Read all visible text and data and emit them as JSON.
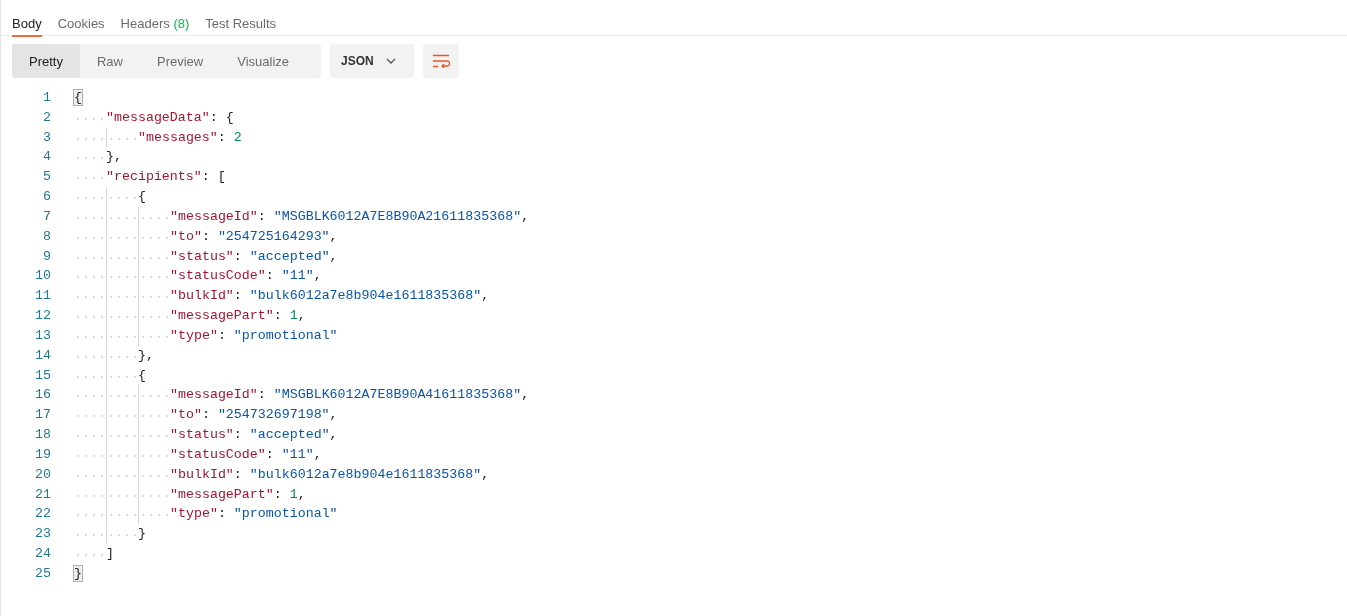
{
  "tabs": [
    {
      "label": "Body",
      "selected": true
    },
    {
      "label": "Cookies",
      "selected": false
    },
    {
      "label": "Headers",
      "count": "(8)",
      "selected": false
    },
    {
      "label": "Test Results",
      "selected": false
    }
  ],
  "view_modes": [
    {
      "label": "Pretty",
      "selected": true
    },
    {
      "label": "Raw",
      "selected": false
    },
    {
      "label": "Preview",
      "selected": false
    },
    {
      "label": "Visualize",
      "selected": false
    }
  ],
  "format_dropdown": {
    "value": "JSON"
  },
  "code": [
    {
      "number": "1",
      "tokens": [
        {
          "kind": "bracket-match",
          "text": "{"
        }
      ],
      "children": [
        {
          "number": "2",
          "tokens": [
            {
              "kind": "key",
              "text": "\"messageData\""
            },
            {
              "kind": "punct",
              "text": ": {"
            }
          ],
          "children": [
            {
              "number": "3",
              "tokens": [
                {
                  "kind": "key",
                  "text": "\"messages\""
                },
                {
                  "kind": "punct",
                  "text": ": "
                },
                {
                  "kind": "number",
                  "text": "2"
                }
              ]
            }
          ]
        },
        {
          "number": "4",
          "tokens": [
            {
              "kind": "punct",
              "text": "},"
            }
          ]
        },
        {
          "number": "5",
          "tokens": [
            {
              "kind": "key",
              "text": "\"recipients\""
            },
            {
              "kind": "punct",
              "text": ": ["
            }
          ],
          "children": [
            {
              "number": "6",
              "tokens": [
                {
                  "kind": "punct",
                  "text": "{"
                }
              ],
              "children": [
                {
                  "number": "7",
                  "tokens": [
                    {
                      "kind": "key",
                      "text": "\"messageId\""
                    },
                    {
                      "kind": "punct",
                      "text": ": "
                    },
                    {
                      "kind": "string",
                      "text": "\"MSGBLK6012A7E8B90A21611835368\""
                    },
                    {
                      "kind": "punct",
                      "text": ","
                    }
                  ]
                },
                {
                  "number": "8",
                  "tokens": [
                    {
                      "kind": "key",
                      "text": "\"to\""
                    },
                    {
                      "kind": "punct",
                      "text": ": "
                    },
                    {
                      "kind": "string",
                      "text": "\"254725164293\""
                    },
                    {
                      "kind": "punct",
                      "text": ","
                    }
                  ]
                },
                {
                  "number": "9",
                  "tokens": [
                    {
                      "kind": "key",
                      "text": "\"status\""
                    },
                    {
                      "kind": "punct",
                      "text": ": "
                    },
                    {
                      "kind": "string",
                      "text": "\"accepted\""
                    },
                    {
                      "kind": "punct",
                      "text": ","
                    }
                  ]
                },
                {
                  "number": "10",
                  "tokens": [
                    {
                      "kind": "key",
                      "text": "\"statusCode\""
                    },
                    {
                      "kind": "punct",
                      "text": ": "
                    },
                    {
                      "kind": "string",
                      "text": "\"11\""
                    },
                    {
                      "kind": "punct",
                      "text": ","
                    }
                  ]
                },
                {
                  "number": "11",
                  "tokens": [
                    {
                      "kind": "key",
                      "text": "\"bulkId\""
                    },
                    {
                      "kind": "punct",
                      "text": ": "
                    },
                    {
                      "kind": "string",
                      "text": "\"bulk6012a7e8b904e1611835368\""
                    },
                    {
                      "kind": "punct",
                      "text": ","
                    }
                  ]
                },
                {
                  "number": "12",
                  "tokens": [
                    {
                      "kind": "key",
                      "text": "\"messagePart\""
                    },
                    {
                      "kind": "punct",
                      "text": ": "
                    },
                    {
                      "kind": "number",
                      "text": "1"
                    },
                    {
                      "kind": "punct",
                      "text": ","
                    }
                  ]
                },
                {
                  "number": "13",
                  "tokens": [
                    {
                      "kind": "key",
                      "text": "\"type\""
                    },
                    {
                      "kind": "punct",
                      "text": ": "
                    },
                    {
                      "kind": "string",
                      "text": "\"promotional\""
                    }
                  ]
                }
              ]
            },
            {
              "number": "14",
              "tokens": [
                {
                  "kind": "punct",
                  "text": "},"
                }
              ]
            },
            {
              "number": "15",
              "tokens": [
                {
                  "kind": "punct",
                  "text": "{"
                }
              ],
              "children": [
                {
                  "number": "16",
                  "tokens": [
                    {
                      "kind": "key",
                      "text": "\"messageId\""
                    },
                    {
                      "kind": "punct",
                      "text": ": "
                    },
                    {
                      "kind": "string",
                      "text": "\"MSGBLK6012A7E8B90A41611835368\""
                    },
                    {
                      "kind": "punct",
                      "text": ","
                    }
                  ]
                },
                {
                  "number": "17",
                  "tokens": [
                    {
                      "kind": "key",
                      "text": "\"to\""
                    },
                    {
                      "kind": "punct",
                      "text": ": "
                    },
                    {
                      "kind": "string",
                      "text": "\"254732697198\""
                    },
                    {
                      "kind": "punct",
                      "text": ","
                    }
                  ]
                },
                {
                  "number": "18",
                  "tokens": [
                    {
                      "kind": "key",
                      "text": "\"status\""
                    },
                    {
                      "kind": "punct",
                      "text": ": "
                    },
                    {
                      "kind": "string",
                      "text": "\"accepted\""
                    },
                    {
                      "kind": "punct",
                      "text": ","
                    }
                  ]
                },
                {
                  "number": "19",
                  "tokens": [
                    {
                      "kind": "key",
                      "text": "\"statusCode\""
                    },
                    {
                      "kind": "punct",
                      "text": ": "
                    },
                    {
                      "kind": "string",
                      "text": "\"11\""
                    },
                    {
                      "kind": "punct",
                      "text": ","
                    }
                  ]
                },
                {
                  "number": "20",
                  "tokens": [
                    {
                      "kind": "key",
                      "text": "\"bulkId\""
                    },
                    {
                      "kind": "punct",
                      "text": ": "
                    },
                    {
                      "kind": "string",
                      "text": "\"bulk6012a7e8b904e1611835368\""
                    },
                    {
                      "kind": "punct",
                      "text": ","
                    }
                  ]
                },
                {
                  "number": "21",
                  "tokens": [
                    {
                      "kind": "key",
                      "text": "\"messagePart\""
                    },
                    {
                      "kind": "punct",
                      "text": ": "
                    },
                    {
                      "kind": "number",
                      "text": "1"
                    },
                    {
                      "kind": "punct",
                      "text": ","
                    }
                  ]
                },
                {
                  "number": "22",
                  "tokens": [
                    {
                      "kind": "key",
                      "text": "\"type\""
                    },
                    {
                      "kind": "punct",
                      "text": ": "
                    },
                    {
                      "kind": "string",
                      "text": "\"promotional\""
                    }
                  ]
                }
              ]
            },
            {
              "number": "23",
              "tokens": [
                {
                  "kind": "punct",
                  "text": "}"
                }
              ]
            }
          ]
        },
        {
          "number": "24",
          "tokens": [
            {
              "kind": "punct",
              "text": "]"
            }
          ]
        }
      ]
    },
    {
      "number": "25",
      "tokens": [
        {
          "kind": "bracket-match",
          "text": "}"
        }
      ]
    }
  ]
}
